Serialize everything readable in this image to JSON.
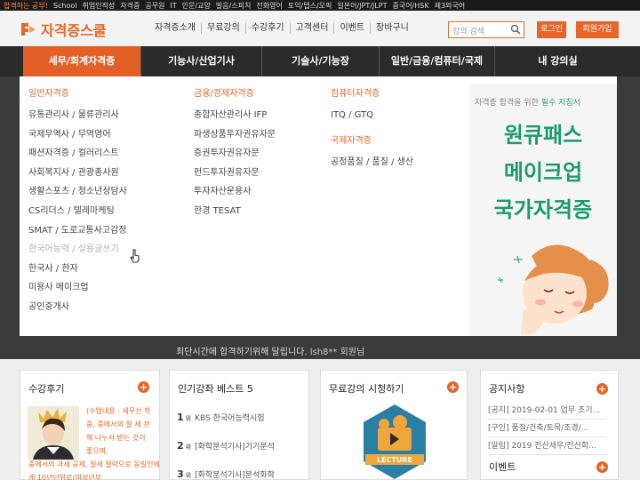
{
  "topstrip": [
    "합격하는 공부!",
    "School",
    "취업인적성",
    "자격증",
    "공무원",
    "IT",
    "인문/교양",
    "발음/스피치",
    "전화영어",
    "토익/텝스/오픽",
    "일본어/JPT/JLPT",
    "중국어/HSK",
    "제3외국어"
  ],
  "header": {
    "logo": "자격증스쿨",
    "nav": [
      "자격증소개",
      "무료강의",
      "수강후기",
      "고객센터",
      "이벤트",
      "장바구니"
    ],
    "search_placeholder": "강의 검색",
    "login": "로그인",
    "join": "회원가입"
  },
  "gnb": [
    "세무/회계자격증",
    "기능사/산업기사",
    "기술사/기능장",
    "일반/금융/컴퓨터/국제",
    "내 강의실"
  ],
  "dropdown": {
    "col1": {
      "category": "일반자격증",
      "links": [
        "유통관리사 / 물류관리사",
        "국제무역사 / 무역영어",
        "패션자격증 / 컬러리스트",
        "사회복지사 / 관광종사원",
        "생활스포츠 / 청소년상담사",
        "CS리더스 / 텔레마케팅",
        "SMAT / 도로교통사고감정",
        "한국어능력 / 실용글쓰기",
        "한국사 / 한자",
        "미용사 메이크업",
        "공인중개사"
      ]
    },
    "col2": {
      "category": "금융/경제자격증",
      "links": [
        "종합자산관리사 IFP",
        "파생상품투자권유자문",
        "증권투자권유자문",
        "펀드투자권유자문",
        "투자자산운용사",
        "한경 TESAT"
      ]
    },
    "col3": {
      "category": "컴퓨터자격증",
      "links": [
        "ITQ / GTQ"
      ],
      "category2": "국제자격증",
      "links2": [
        "공정품질 / 품질 / 생산"
      ]
    }
  },
  "promo": {
    "sub_prefix": "자격증 합격을 위한 ",
    "sub_em": "필수 지침서",
    "line1": "원큐패스",
    "line2": "메이크업",
    "line3": "국가자격증"
  },
  "ticker": {
    "text": "최단시간에 합격하기위해 달립니다.",
    "name": "lsh8** 회원님"
  },
  "cards": {
    "review": {
      "title": "수강후기",
      "text1": "(수업내용 : 세무선 학중, 중에서의 절 세 관해 나누서 받는 것이 좋으며,",
      "text2": "중에서의 과세 공제, 절세 절략으로 동일인에게 10년단위로(미성년부"
    },
    "best": {
      "title": "인기강좌 베스트 5",
      "items": [
        {
          "rank": "1",
          "suffix": "위",
          "label": "KBS 한국어능력시험"
        },
        {
          "rank": "2",
          "suffix": "위",
          "label": "[화학분석기사]기기분석"
        },
        {
          "rank": "3",
          "suffix": "위",
          "label": "[화학분석기사]분석화학"
        }
      ]
    },
    "free": {
      "title": "무료강의 시청하기",
      "badge": "LECTURE"
    },
    "notice": {
      "title": "공지사항",
      "items": [
        "[공지] 2019-02-01 업무 조기...",
        "[구인] 품질/건축/토목/조경/...",
        "[알림] 2019 전산세무/전산회..."
      ],
      "event_title": "이벤트"
    }
  },
  "colors": {
    "accent": "#e8652a",
    "green": "#1a9a70",
    "dark_bar": "#2b2b2b"
  }
}
